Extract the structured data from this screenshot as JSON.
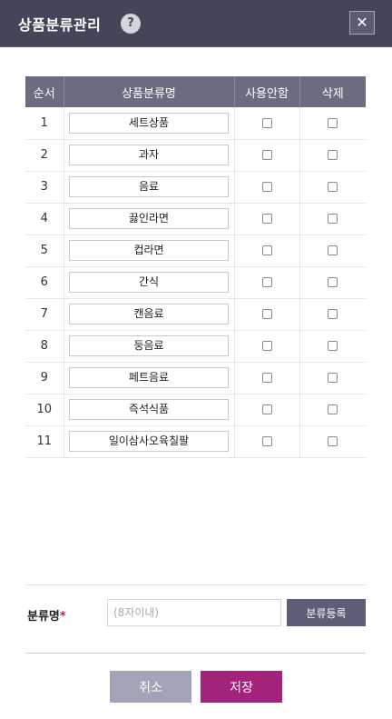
{
  "dialog": {
    "title": "상품분류관리",
    "help_icon": "?",
    "close_icon": "✕"
  },
  "table": {
    "headers": {
      "order": "순서",
      "name": "상품분류명",
      "disable": "사용안함",
      "delete": "삭제"
    },
    "rows": [
      {
        "order": "1",
        "name": "세트상품",
        "disable": false,
        "delete": false
      },
      {
        "order": "2",
        "name": "과자",
        "disable": false,
        "delete": false
      },
      {
        "order": "3",
        "name": "음료",
        "disable": false,
        "delete": false
      },
      {
        "order": "4",
        "name": "끓인라면",
        "disable": false,
        "delete": false
      },
      {
        "order": "5",
        "name": "컵라면",
        "disable": false,
        "delete": false
      },
      {
        "order": "6",
        "name": "간식",
        "disable": false,
        "delete": false
      },
      {
        "order": "7",
        "name": "캔음료",
        "disable": false,
        "delete": false
      },
      {
        "order": "8",
        "name": "둥음료",
        "disable": false,
        "delete": false
      },
      {
        "order": "9",
        "name": "페트음료",
        "disable": false,
        "delete": false
      },
      {
        "order": "10",
        "name": "즉석식품",
        "disable": false,
        "delete": false
      },
      {
        "order": "11",
        "name": "일이삼사오육칠팔",
        "disable": false,
        "delete": false
      }
    ]
  },
  "form": {
    "label": "분류명",
    "required_mark": "*",
    "placeholder": "(8자이내)",
    "value": "",
    "register_label": "분류등록"
  },
  "actions": {
    "cancel_label": "취소",
    "save_label": "저장"
  }
}
